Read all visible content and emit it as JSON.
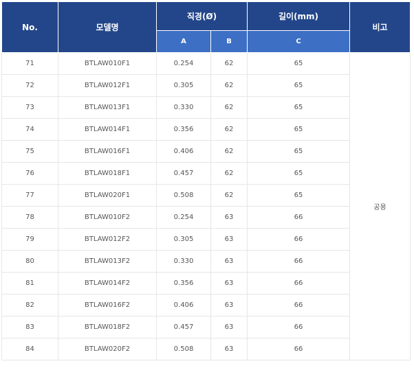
{
  "headers": {
    "no": "No.",
    "model": "모델명",
    "diameter": "직경(Ø)",
    "length": "길이(mm)",
    "remark": "비고",
    "col_a": "A",
    "col_b": "B",
    "col_c": "C"
  },
  "rows": [
    {
      "no": "71",
      "model": "BTLAW010F1",
      "a": "0.254",
      "b": "62",
      "c": "65"
    },
    {
      "no": "72",
      "model": "BTLAW012F1",
      "a": "0.305",
      "b": "62",
      "c": "65"
    },
    {
      "no": "73",
      "model": "BTLAW013F1",
      "a": "0.330",
      "b": "62",
      "c": "65"
    },
    {
      "no": "74",
      "model": "BTLAW014F1",
      "a": "0.356",
      "b": "62",
      "c": "65"
    },
    {
      "no": "75",
      "model": "BTLAW016F1",
      "a": "0.406",
      "b": "62",
      "c": "65"
    },
    {
      "no": "76",
      "model": "BTLAW018F1",
      "a": "0.457",
      "b": "62",
      "c": "65"
    },
    {
      "no": "77",
      "model": "BTLAW020F1",
      "a": "0.508",
      "b": "62",
      "c": "65"
    },
    {
      "no": "78",
      "model": "BTLAW010F2",
      "a": "0.254",
      "b": "63",
      "c": "66"
    },
    {
      "no": "79",
      "model": "BTLAW012F2",
      "a": "0.305",
      "b": "63",
      "c": "66"
    },
    {
      "no": "80",
      "model": "BTLAW013F2",
      "a": "0.330",
      "b": "63",
      "c": "66"
    },
    {
      "no": "81",
      "model": "BTLAW014F2",
      "a": "0.356",
      "b": "63",
      "c": "66"
    },
    {
      "no": "82",
      "model": "BTLAW016F2",
      "a": "0.406",
      "b": "63",
      "c": "66"
    },
    {
      "no": "83",
      "model": "BTLAW018F2",
      "a": "0.457",
      "b": "63",
      "c": "66"
    },
    {
      "no": "84",
      "model": "BTLAW020F2",
      "a": "0.508",
      "b": "63",
      "c": "66"
    }
  ],
  "remark_value": "공용",
  "colors": {
    "header_dark": "#23468a",
    "header_light": "#3d70c5",
    "cell_text": "#555555",
    "border": "#e6e6e6"
  }
}
